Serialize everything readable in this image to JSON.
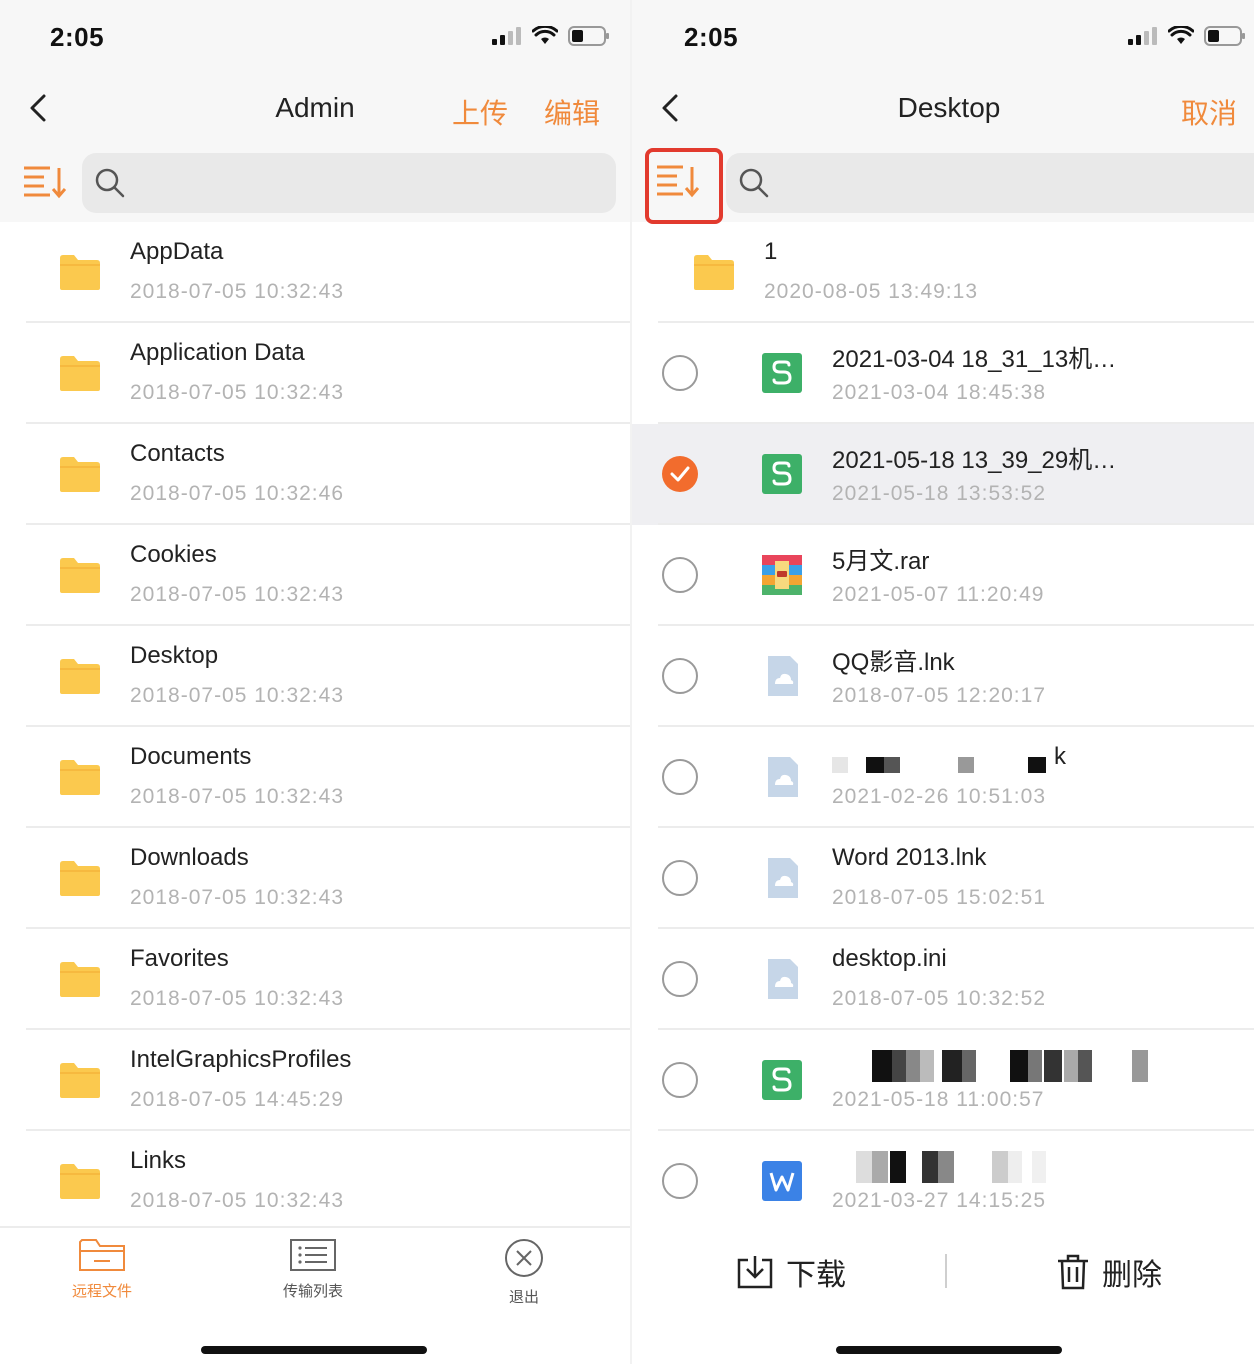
{
  "left": {
    "status": {
      "time": "2:05"
    },
    "nav": {
      "title": "Admin",
      "upload": "上传",
      "edit": "编辑"
    },
    "search": {
      "placeholder": ""
    },
    "items": [
      {
        "name": "AppData",
        "date": "2018-07-05 10:32:43"
      },
      {
        "name": "Application Data",
        "date": "2018-07-05 10:32:43"
      },
      {
        "name": "Contacts",
        "date": "2018-07-05 10:32:46"
      },
      {
        "name": "Cookies",
        "date": "2018-07-05 10:32:43"
      },
      {
        "name": "Desktop",
        "date": "2018-07-05 10:32:43"
      },
      {
        "name": "Documents",
        "date": "2018-07-05 10:32:43"
      },
      {
        "name": "Downloads",
        "date": "2018-07-05 10:32:43"
      },
      {
        "name": "Favorites",
        "date": "2018-07-05 10:32:43"
      },
      {
        "name": "IntelGraphicsProfiles",
        "date": "2018-07-05 14:45:29"
      },
      {
        "name": "Links",
        "date": "2018-07-05 10:32:43"
      }
    ],
    "tabs": [
      {
        "label": "远程文件",
        "icon": "folder-outline-icon",
        "active": true
      },
      {
        "label": "传输列表",
        "icon": "list-icon",
        "active": false
      },
      {
        "label": "退出",
        "icon": "close-circle-icon",
        "active": false
      }
    ]
  },
  "right": {
    "status": {
      "time": "2:05"
    },
    "nav": {
      "title": "Desktop",
      "cancel": "取消"
    },
    "search": {
      "placeholder": ""
    },
    "items": [
      {
        "name": "1",
        "date": "2020-08-05 13:49:13",
        "type": "folder",
        "icon": "folder-icon"
      },
      {
        "name": "2021-03-04 18_31_13机…",
        "date": "2021-03-04 18:45:38",
        "type": "sheet",
        "icon": "spreadsheet-file-icon",
        "selected": false
      },
      {
        "name": "2021-05-18 13_39_29机…",
        "date": "2021-05-18 13:53:52",
        "type": "sheet",
        "icon": "spreadsheet-file-icon",
        "selected": true
      },
      {
        "name": "5月文.rar",
        "date": "2021-05-07 11:20:49",
        "type": "rar",
        "icon": "archive-file-icon",
        "selected": false
      },
      {
        "name": "QQ影音.lnk",
        "date": "2018-07-05 12:20:17",
        "type": "generic",
        "icon": "generic-file-icon",
        "selected": false
      },
      {
        "name": "k",
        "date": "2021-02-26 10:51:03",
        "type": "generic",
        "icon": "generic-file-icon",
        "selected": false,
        "obscured": true
      },
      {
        "name": "Word 2013.lnk",
        "date": "2018-07-05 15:02:51",
        "type": "generic",
        "icon": "generic-file-icon",
        "selected": false
      },
      {
        "name": "desktop.ini",
        "date": "2018-07-05 10:32:52",
        "type": "generic",
        "icon": "generic-file-icon",
        "selected": false
      },
      {
        "name": "",
        "date": "2021-05-18 11:00:57",
        "type": "sheet",
        "icon": "spreadsheet-file-icon",
        "selected": false,
        "obscured": true
      },
      {
        "name": "",
        "date": "2021-03-27 14:15:25",
        "type": "word",
        "icon": "word-file-icon",
        "selected": false,
        "obscured": true
      }
    ],
    "actions": {
      "download": "下载",
      "delete": "删除"
    }
  },
  "colors": {
    "accent": "#f08a3c",
    "check": "#f26c2d",
    "highlight": "#e23a2e",
    "folder": "#fbc94e",
    "sheet": "#3db068",
    "word": "#3b82e6",
    "generic": "#c6d6e8"
  }
}
